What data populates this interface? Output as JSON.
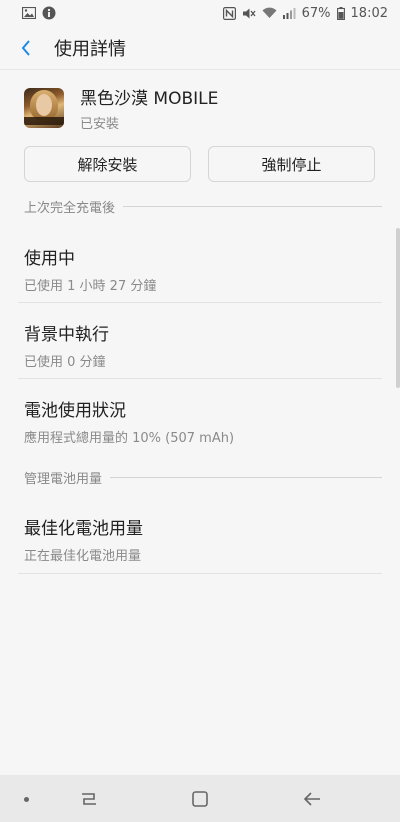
{
  "status_bar": {
    "battery_percent": "67%",
    "time": "18:02",
    "icons": [
      "gallery-icon",
      "info-icon",
      "nfc-icon",
      "mute-icon",
      "wifi-icon",
      "signal-icon",
      "battery-icon"
    ]
  },
  "app_bar": {
    "title": "使用詳情"
  },
  "app": {
    "name": "黑色沙漠 MOBILE",
    "status": "已安裝"
  },
  "buttons": {
    "uninstall": "解除安裝",
    "force_stop": "強制停止"
  },
  "sections": {
    "since_last_charge": "上次完全充電後",
    "manage_battery": "管理電池用量"
  },
  "items": [
    {
      "title": "使用中",
      "subtitle": "已使用 1 小時 27 分鐘"
    },
    {
      "title": "背景中執行",
      "subtitle": "已使用 0 分鐘"
    },
    {
      "title": "電池使用狀況",
      "subtitle": "應用程式總用量的 10% (507 mAh)"
    },
    {
      "title": "最佳化電池用量",
      "subtitle": "正在最佳化電池用量"
    }
  ],
  "colors": {
    "background": "#f6f6f6",
    "accent": "#1e88e5",
    "nav_bar": "#e9e9e9"
  }
}
